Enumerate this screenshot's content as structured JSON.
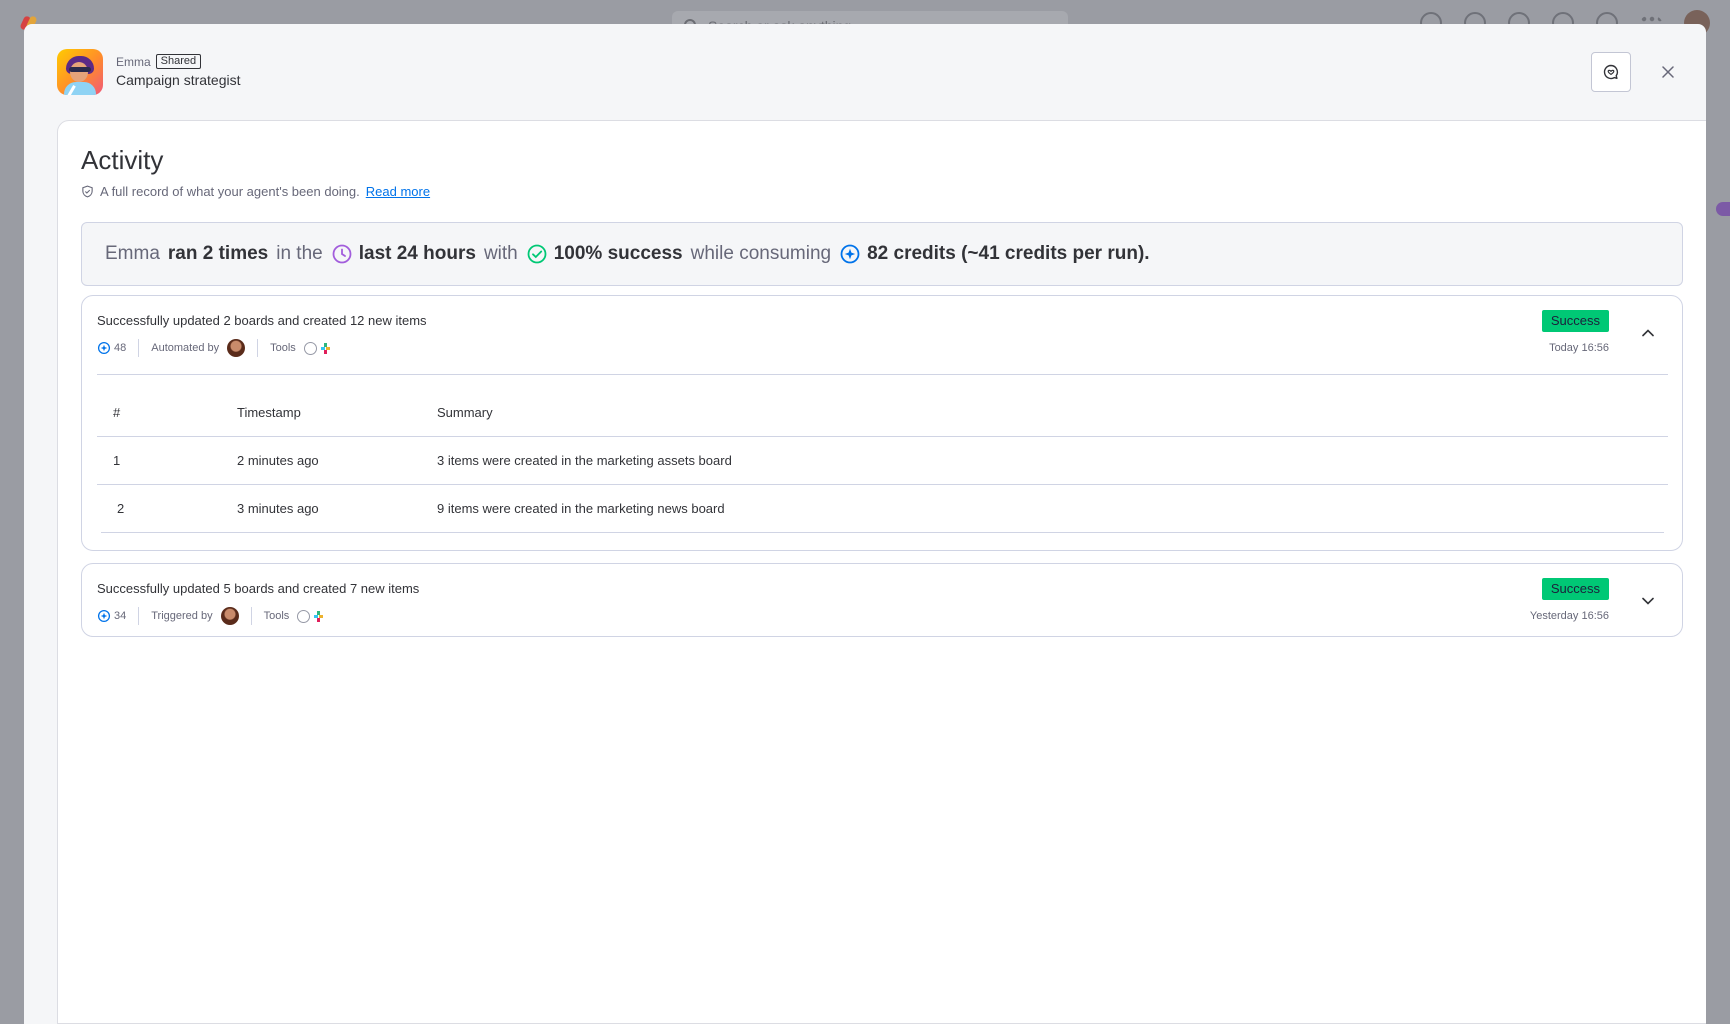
{
  "background": {
    "search_placeholder": "Search or ask anything"
  },
  "header": {
    "agent_name": "Emma",
    "shared_badge": "Shared",
    "agent_role": "Campaign strategist"
  },
  "activity": {
    "title": "Activity",
    "subtitle": "A full record of what your agent's been doing.",
    "read_more": "Read more"
  },
  "summary": {
    "name": "Emma",
    "runs": "ran 2 times",
    "in_the": "in the",
    "period": "last 24 hours",
    "with": "with",
    "success": "100% success",
    "while_consuming": "while consuming",
    "credits": "82 credits (~41 credits per run)."
  },
  "runs": [
    {
      "title": "Successfully updated 2 boards and created 12 new items",
      "credits": "48",
      "actor_label": "Automated by",
      "tools_label": "Tools",
      "status": "Success",
      "time": "Today 16:56",
      "table": {
        "headers": [
          "#",
          "Timestamp",
          "Summary"
        ],
        "rows": [
          {
            "num": "1",
            "timestamp": "2 minutes ago",
            "summary": "3 items were created in the marketing assets board"
          },
          {
            "num": "2",
            "timestamp": "3 minutes ago",
            "summary": "9 items were created in the marketing news board"
          }
        ]
      }
    },
    {
      "title": "Successfully updated 5 boards and created 7 new items",
      "credits": "34",
      "actor_label": "Triggered by",
      "tools_label": "Tools",
      "status": "Success",
      "time": "Yesterday 16:56"
    }
  ],
  "colors": {
    "success": "#00c875",
    "link": "#0073ea",
    "clock": "#a25ddc",
    "check": "#00c875",
    "credit": "#0073ea"
  }
}
